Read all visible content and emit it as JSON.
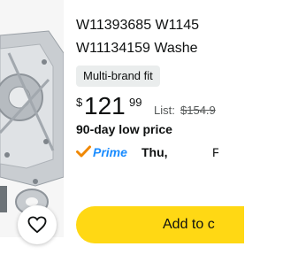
{
  "product": {
    "title_line1": "W11393685 W1145",
    "title_line2": "W11134159 Washe",
    "badge": "Multi-brand fit"
  },
  "price": {
    "symbol": "$",
    "whole": "121",
    "fraction": "99",
    "list_label": "List:",
    "list_value": "$154.9"
  },
  "deal": {
    "label": "90-day low price"
  },
  "delivery": {
    "prime_label": "Prime",
    "day": "Thu,",
    "extra": "F"
  },
  "actions": {
    "add_to_cart_label": "Add to c"
  },
  "colors": {
    "add_to_cart_bg": "#ffd814",
    "prime_blue": "#1a8cff",
    "prime_check": "#f08804",
    "badge_bg": "#eaeded"
  },
  "icons": {
    "favorite": "heart-icon",
    "prime": "checkmark-icon"
  }
}
